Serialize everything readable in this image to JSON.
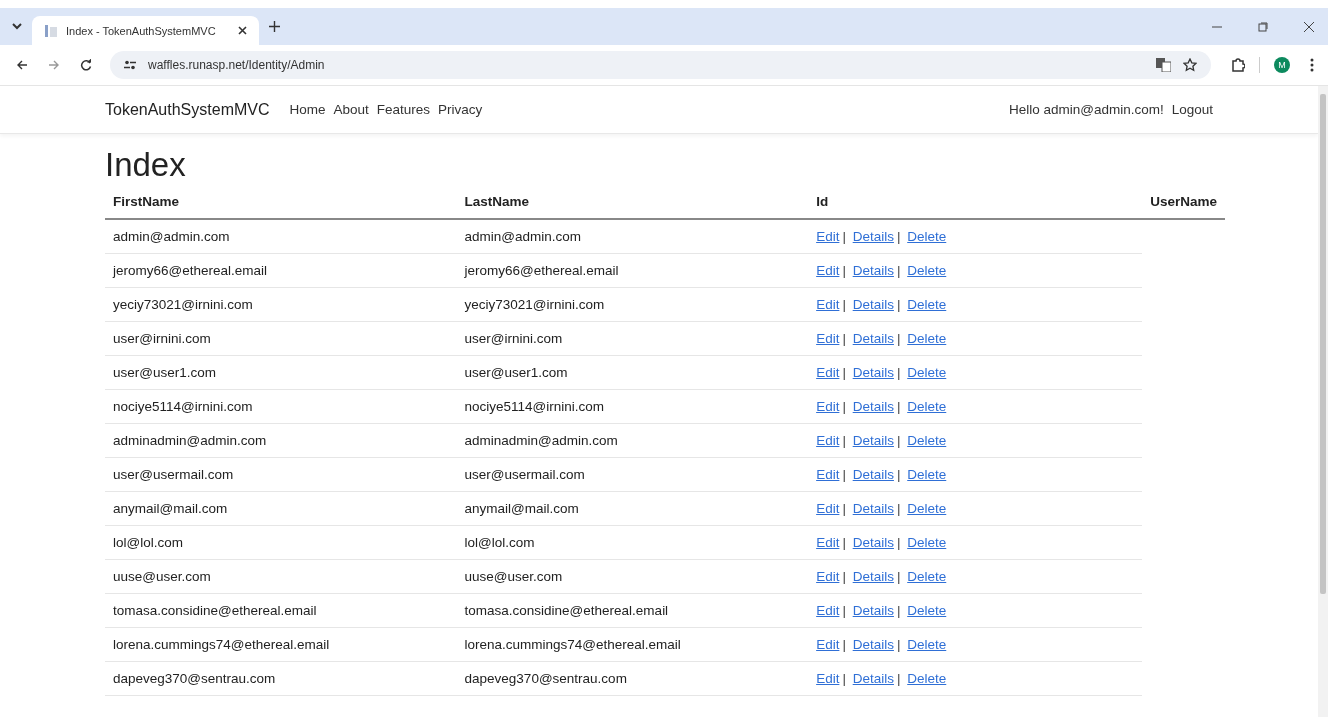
{
  "browser": {
    "tabs": [
      {
        "title": "Index - TokenAuthSystemMVC",
        "selected": true
      }
    ],
    "url": "waffles.runasp.net/Identity/Admin",
    "profile_initial": "M"
  },
  "navbar": {
    "brand": "TokenAuthSystemMVC",
    "links": [
      "Home",
      "About",
      "Features",
      "Privacy"
    ],
    "greeting": "Hello admin@admin.com!",
    "logout": "Logout"
  },
  "page": {
    "heading": "Index"
  },
  "table": {
    "columns": [
      "FirstName",
      "LastName",
      "Id",
      "UserName"
    ],
    "separator": "|",
    "rows": [
      {
        "first_name": "admin@admin.com",
        "last_name": "admin@admin.com",
        "actions": [
          "Edit",
          "Details",
          "Delete"
        ]
      },
      {
        "first_name": "jeromy66@ethereal.email",
        "last_name": "jeromy66@ethereal.email",
        "actions": [
          "Edit",
          "Details",
          "Delete"
        ]
      },
      {
        "first_name": "yeciy73021@irnini.com",
        "last_name": "yeciy73021@irnini.com",
        "actions": [
          "Edit",
          "Details",
          "Delete"
        ]
      },
      {
        "first_name": "user@irnini.com",
        "last_name": "user@irnini.com",
        "actions": [
          "Edit",
          "Details",
          "Delete"
        ]
      },
      {
        "first_name": "user@user1.com",
        "last_name": "user@user1.com",
        "actions": [
          "Edit",
          "Details",
          "Delete"
        ]
      },
      {
        "first_name": "nociye5114@irnini.com",
        "last_name": "nociye5114@irnini.com",
        "actions": [
          "Edit",
          "Details",
          "Delete"
        ]
      },
      {
        "first_name": "adminadmin@admin.com",
        "last_name": "adminadmin@admin.com",
        "actions": [
          "Edit",
          "Details",
          "Delete"
        ]
      },
      {
        "first_name": "user@usermail.com",
        "last_name": "user@usermail.com",
        "actions": [
          "Edit",
          "Details",
          "Delete"
        ]
      },
      {
        "first_name": "anymail@mail.com",
        "last_name": "anymail@mail.com",
        "actions": [
          "Edit",
          "Details",
          "Delete"
        ]
      },
      {
        "first_name": "lol@lol.com",
        "last_name": "lol@lol.com",
        "actions": [
          "Edit",
          "Details",
          "Delete"
        ]
      },
      {
        "first_name": "uuse@user.com",
        "last_name": "uuse@user.com",
        "actions": [
          "Edit",
          "Details",
          "Delete"
        ]
      },
      {
        "first_name": "tomasa.considine@ethereal.email",
        "last_name": "tomasa.considine@ethereal.email",
        "actions": [
          "Edit",
          "Details",
          "Delete"
        ]
      },
      {
        "first_name": "lorena.cummings74@ethereal.email",
        "last_name": "lorena.cummings74@ethereal.email",
        "actions": [
          "Edit",
          "Details",
          "Delete"
        ]
      },
      {
        "first_name": "dapeveg370@sentrau.com",
        "last_name": "dapeveg370@sentrau.com",
        "actions": [
          "Edit",
          "Details",
          "Delete"
        ]
      }
    ]
  }
}
